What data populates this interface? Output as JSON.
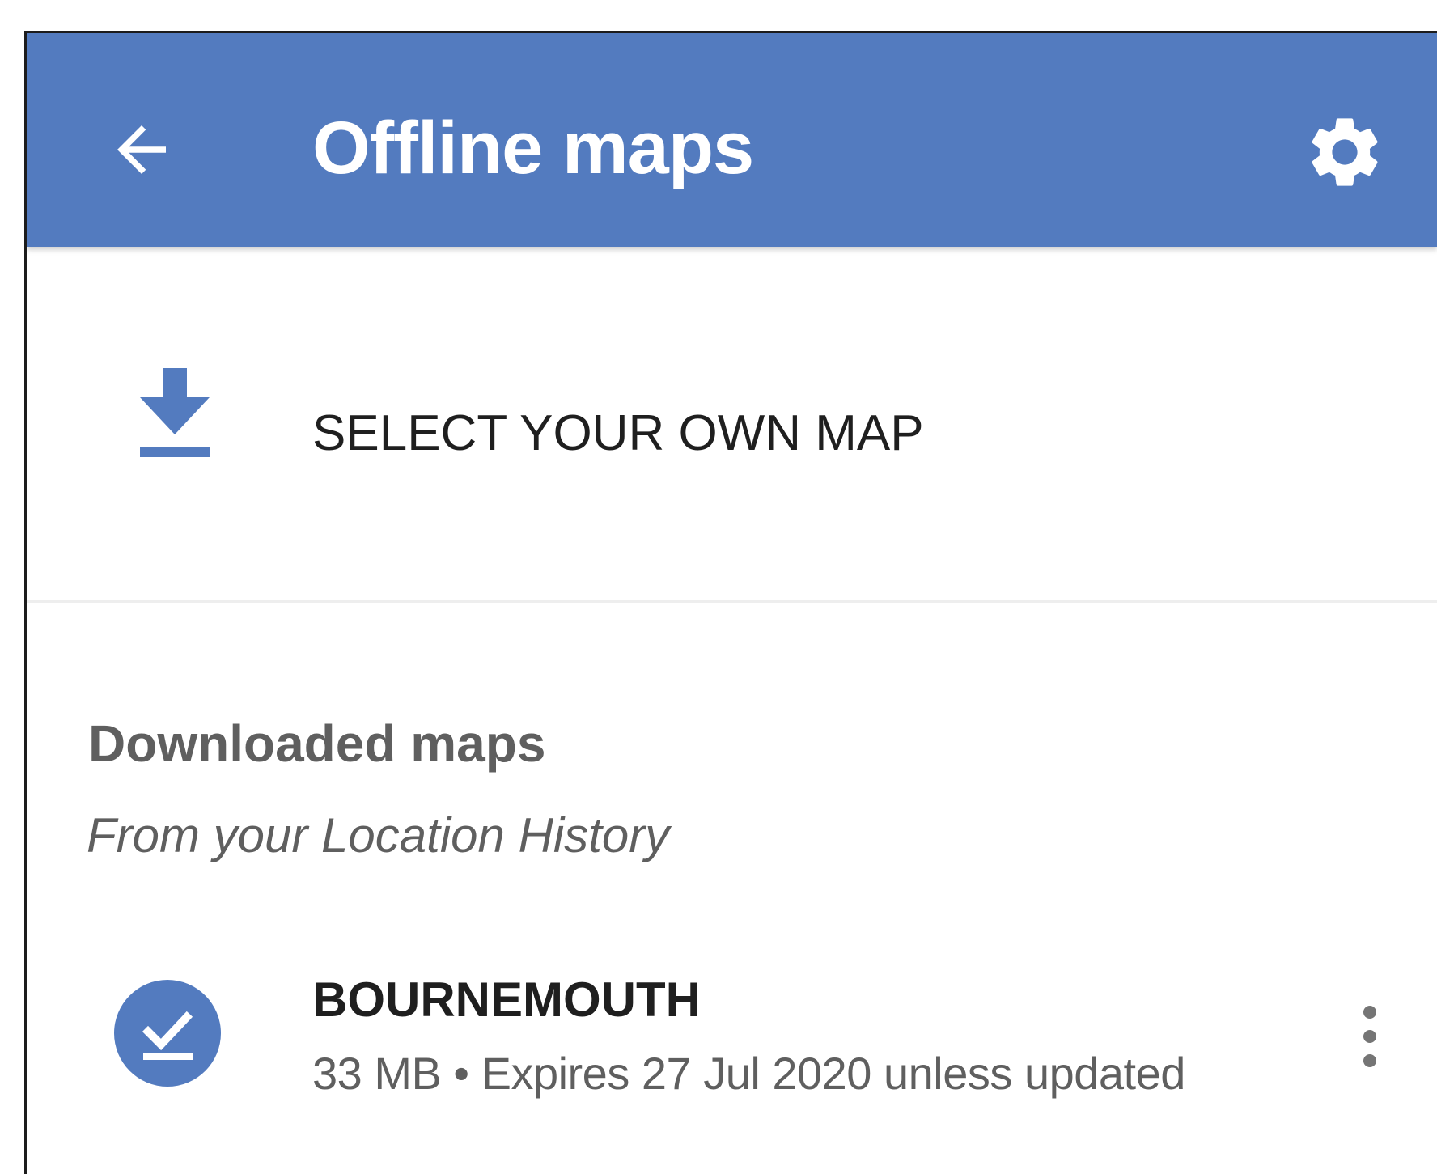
{
  "appbar": {
    "title": "Offline maps",
    "back_icon": "arrow-left-icon",
    "settings_icon": "gear-icon",
    "color": "#537bbf"
  },
  "select_map": {
    "label": "SELECT YOUR OWN MAP",
    "icon": "download-icon",
    "icon_color": "#537bbf"
  },
  "downloaded": {
    "title": "Downloaded maps",
    "subtitle": "From your Location History",
    "items": [
      {
        "name": "BOURNEMOUTH",
        "size": "33 MB",
        "separator": "•",
        "expiry": "Expires 27 Jul 2020 unless updated",
        "icon": "check-circle-icon",
        "menu_icon": "more-vert-icon"
      }
    ]
  }
}
